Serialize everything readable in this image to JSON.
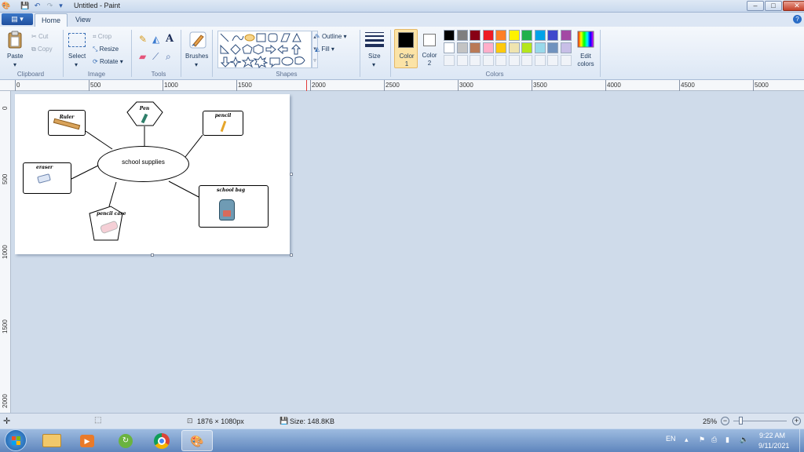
{
  "window": {
    "title": "Untitled - Paint",
    "minimize": "–",
    "maximize": "□",
    "close": "✕"
  },
  "tabs": {
    "file": "▤ ▾",
    "home": "Home",
    "view": "View",
    "help": "?"
  },
  "ribbon": {
    "clipboard": {
      "paste": "Paste",
      "cut": "Cut",
      "copy": "Copy",
      "label": "Clipboard"
    },
    "image": {
      "select": "Select",
      "crop": "Crop",
      "resize": "Resize",
      "rotate": "Rotate ▾",
      "label": "Image"
    },
    "tools": {
      "label": "Tools",
      "text_tool": "A"
    },
    "brushes": {
      "label": "Brushes"
    },
    "shapes": {
      "outline": "Outline ▾",
      "fill": "Fill ▾",
      "label": "Shapes"
    },
    "size": {
      "label": "Size"
    },
    "colors": {
      "color1": "Color 1",
      "color2": "Color 2",
      "edit": "Edit colors",
      "label": "Colors",
      "color1_value": "#000000",
      "color2_value": "#ffffff",
      "palette_row1": [
        "#000000",
        "#7f7f7f",
        "#880015",
        "#ed1c24",
        "#ff7f27",
        "#fff200",
        "#22b14c",
        "#00a2e8",
        "#3f48cc",
        "#a349a4"
      ],
      "palette_row2": [
        "#ffffff",
        "#c3c3c3",
        "#b97a57",
        "#ffaec9",
        "#ffc90e",
        "#efe4b0",
        "#b5e61d",
        "#99d9ea",
        "#7092be",
        "#c8bfe7"
      ]
    }
  },
  "ruler": {
    "h_labels": [
      "0",
      "500",
      "1000",
      "1500",
      "2000",
      "2500",
      "3000",
      "3500",
      "4000",
      "4500",
      "5000"
    ],
    "v_labels": [
      "0",
      "500",
      "1000",
      "1500",
      "2000"
    ]
  },
  "canvas": {
    "center_label": "school supplies",
    "nodes": {
      "ruler": "Ruler",
      "pen": "Pen",
      "pencil": "pencil",
      "eraser": "eraser",
      "school_bag": "school bag",
      "pencil_case": "pencil case"
    }
  },
  "status": {
    "dimensions": "1876 × 1080px",
    "size": "Size: 148.8KB",
    "zoom": "25%"
  },
  "taskbar": {
    "lang": "EN",
    "time": "9:22 AM",
    "date": "9/11/2021"
  }
}
